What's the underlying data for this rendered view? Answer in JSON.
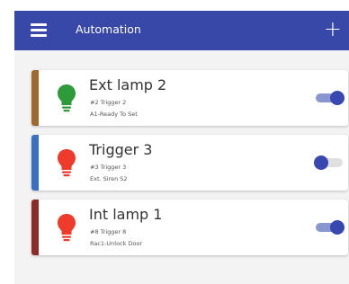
{
  "app_bar": {
    "title": "Automation",
    "menu_icon": "hamburger-menu-icon",
    "add_icon": "plus-icon",
    "color": "#3848a8"
  },
  "automations": [
    {
      "name": "Ext lamp 2",
      "trigger": "#2 Trigger 2",
      "action": "A1-Ready To Set",
      "stripe_color": "#a0692e",
      "bulb_color": "#2e9b3a",
      "icon": "lightbulb-icon",
      "enabled": true
    },
    {
      "name": "Trigger 3",
      "trigger": "#3 Trigger 3",
      "action": "Ext. Siren S2",
      "stripe_color": "#3a6fc4",
      "bulb_color": "#ee3b2c",
      "icon": "lightbulb-icon",
      "enabled": false
    },
    {
      "name": "Int lamp 1",
      "trigger": "#8 Trigger 8",
      "action": "Rac1-Unlock Door",
      "stripe_color": "#8d2a2a",
      "bulb_color": "#ee3b2c",
      "icon": "lightbulb-icon",
      "enabled": true
    }
  ]
}
